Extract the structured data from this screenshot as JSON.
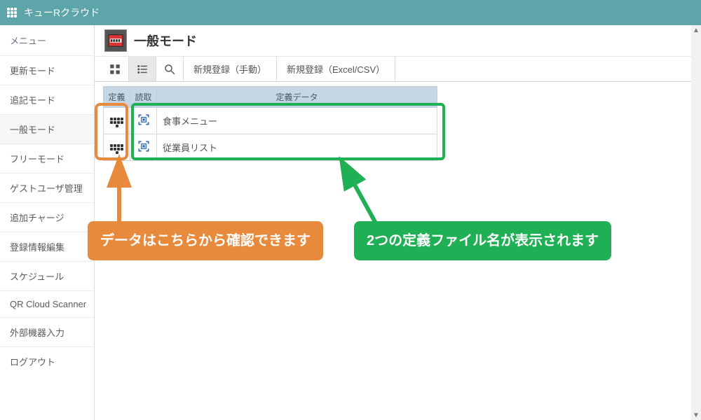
{
  "header": {
    "title": "キューRクラウド"
  },
  "sidebar": {
    "title": "メニュー",
    "items": [
      {
        "label": "更新モード"
      },
      {
        "label": "追記モード"
      },
      {
        "label": "一般モード",
        "active": true
      },
      {
        "label": "フリーモード"
      },
      {
        "label": "ゲストユーザ管理"
      },
      {
        "label": "追加チャージ"
      },
      {
        "label": "登録情報編集"
      },
      {
        "label": "スケジュール"
      },
      {
        "label": "QR Cloud Scanner"
      },
      {
        "label": "外部機器入力"
      },
      {
        "label": "ログアウト"
      }
    ]
  },
  "page": {
    "title": "一般モード"
  },
  "toolbar": {
    "grid_icon": "grid-icon",
    "list_icon": "list-icon",
    "search_icon": "search-icon",
    "manual": "新規登録（手動）",
    "excel": "新規登録（Excel/CSV）"
  },
  "table": {
    "headers": {
      "col1": "定義",
      "col2": "読取",
      "col3": "定義データ"
    },
    "rows": [
      {
        "name": "食事メニュー"
      },
      {
        "name": "従業員リスト"
      }
    ]
  },
  "callouts": {
    "orange": "データはこちらから確認できます",
    "green": "2つの定義ファイル名が表示されます"
  }
}
